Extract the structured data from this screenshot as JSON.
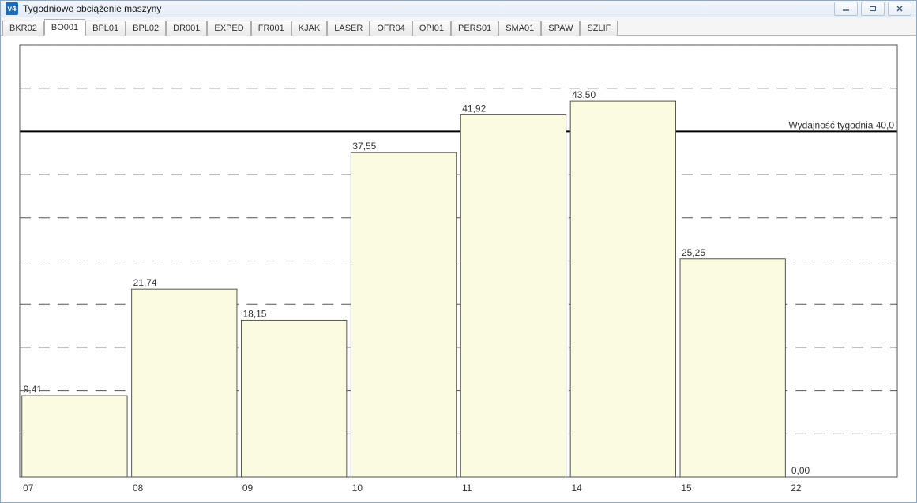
{
  "window": {
    "title": "Tygodniowe obciążenie maszyny",
    "icon_text": "v4"
  },
  "tabs": [
    {
      "label": "BKR02",
      "active": false
    },
    {
      "label": "BO001",
      "active": true
    },
    {
      "label": "BPL01",
      "active": false
    },
    {
      "label": "BPL02",
      "active": false
    },
    {
      "label": "DR001",
      "active": false
    },
    {
      "label": "EXPED",
      "active": false
    },
    {
      "label": "FR001",
      "active": false
    },
    {
      "label": "KJAK",
      "active": false
    },
    {
      "label": "LASER",
      "active": false
    },
    {
      "label": "OFR04",
      "active": false
    },
    {
      "label": "OPI01",
      "active": false
    },
    {
      "label": "PERS01",
      "active": false
    },
    {
      "label": "SMA01",
      "active": false
    },
    {
      "label": "SPAW",
      "active": false
    },
    {
      "label": "SZLIF",
      "active": false
    }
  ],
  "chart_data": {
    "type": "bar",
    "categories": [
      "07",
      "08",
      "09",
      "10",
      "11",
      "14",
      "15",
      "22"
    ],
    "values": [
      9.41,
      21.74,
      18.15,
      37.55,
      41.92,
      43.5,
      25.25,
      0.0
    ],
    "value_labels": [
      "9,41",
      "21,74",
      "18,15",
      "37,55",
      "41,92",
      "43,50",
      "25,25",
      "0,00"
    ],
    "xlabel": "",
    "ylabel": "",
    "ylim": [
      0,
      50
    ],
    "threshold": {
      "value": 40.0,
      "label": "Wydajność tygodnia 40,0"
    },
    "gridline_values": [
      5,
      10,
      15,
      20,
      25,
      30,
      35,
      45,
      50
    ]
  },
  "colors": {
    "bar_fill": "#fbfbe0",
    "bar_stroke": "#555555",
    "threshold": "#000000"
  }
}
